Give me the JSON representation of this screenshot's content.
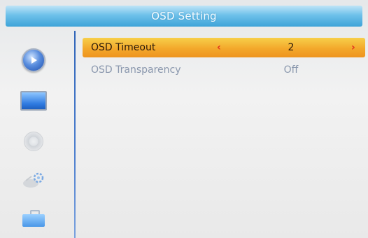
{
  "title": "OSD Setting",
  "sidebar": {
    "items": [
      {
        "icon": "play-icon",
        "active": true
      },
      {
        "icon": "tv-icon",
        "active": false
      },
      {
        "icon": "disc-icon",
        "active": false
      },
      {
        "icon": "satellite-gear-icon",
        "active": false
      },
      {
        "icon": "toolbox-icon",
        "active": false
      }
    ]
  },
  "settings": [
    {
      "label": "OSD Timeout",
      "value": "2",
      "selected": true,
      "left_arrow": "‹",
      "right_arrow": "›"
    },
    {
      "label": "OSD Transparency",
      "value": "Off",
      "selected": false
    }
  ],
  "colors": {
    "title_bar": "#4aa9dc",
    "selected_row": "#f3a82b",
    "arrow": "#e2331d",
    "normal_text": "#8a97ad",
    "sidebar_line": "#2f64b8"
  }
}
